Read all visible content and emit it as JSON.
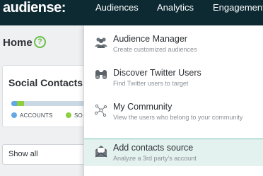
{
  "nav": {
    "logo": "audiense",
    "items": [
      "Audiences",
      "Analytics",
      "Engagement"
    ]
  },
  "page": {
    "title": "Home",
    "help": "?"
  },
  "card": {
    "title": "Social Contacts",
    "legend": [
      "ACCOUNTS",
      "SO"
    ],
    "bar": {
      "accounts_fraction": 0.07,
      "social_fraction": 0.08
    }
  },
  "filter": {
    "selected": "Show all"
  },
  "menu": {
    "items": [
      {
        "title": "Audience Manager",
        "desc": "Create customized audiences",
        "icon": "people-icon"
      },
      {
        "title": "Discover Twitter Users",
        "desc": "Find Twitter users to target",
        "icon": "binoculars-icon"
      },
      {
        "title": "My Community",
        "desc": "View the users who belong to your community",
        "icon": "network-icon"
      },
      {
        "title": "Add contacts source",
        "desc": "Analyze a 3rd party's account",
        "icon": "envelope-icon"
      }
    ]
  },
  "colors": {
    "nav_bg": "#0d2a33",
    "accent_green": "#6cc04a",
    "accounts_blue": "#62a8e5",
    "social_green": "#8ecf3f",
    "highlight_bg": "#e3f1ef"
  }
}
